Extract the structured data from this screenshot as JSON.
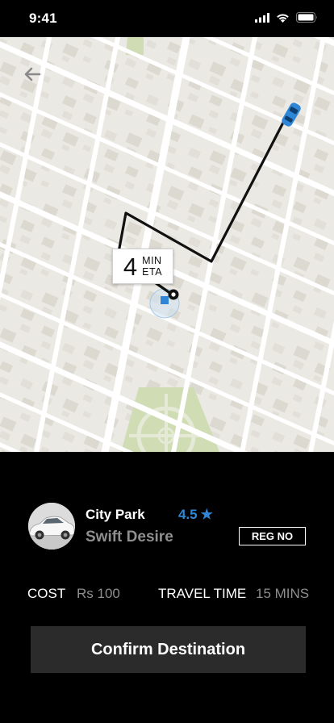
{
  "status_bar": {
    "time": "9:41",
    "icons": [
      "signal-icon",
      "wifi-icon",
      "battery-icon"
    ]
  },
  "map": {
    "back_icon": "arrow-left-icon",
    "eta": {
      "number": "4",
      "unit_top": "MIN",
      "unit_bottom": "ETA"
    },
    "colors": {
      "route": "#111111",
      "car": "#2f86d6",
      "park": "#cfdcb4"
    }
  },
  "ride": {
    "destination": "City Park",
    "car_name": "Swift Desire",
    "rating": "4.5",
    "rating_icon": "★",
    "reg_label": "REG NO"
  },
  "details": {
    "cost_label": "COST",
    "cost_value": "Rs 100",
    "travel_time_label": "TRAVEL TIME",
    "travel_time_value": "15 MINS"
  },
  "actions": {
    "confirm_label": "Confirm Destination"
  },
  "theme": {
    "accent": "#2f86d6",
    "button_bg": "#2b2b2b",
    "muted_text": "#8e8e8e"
  }
}
